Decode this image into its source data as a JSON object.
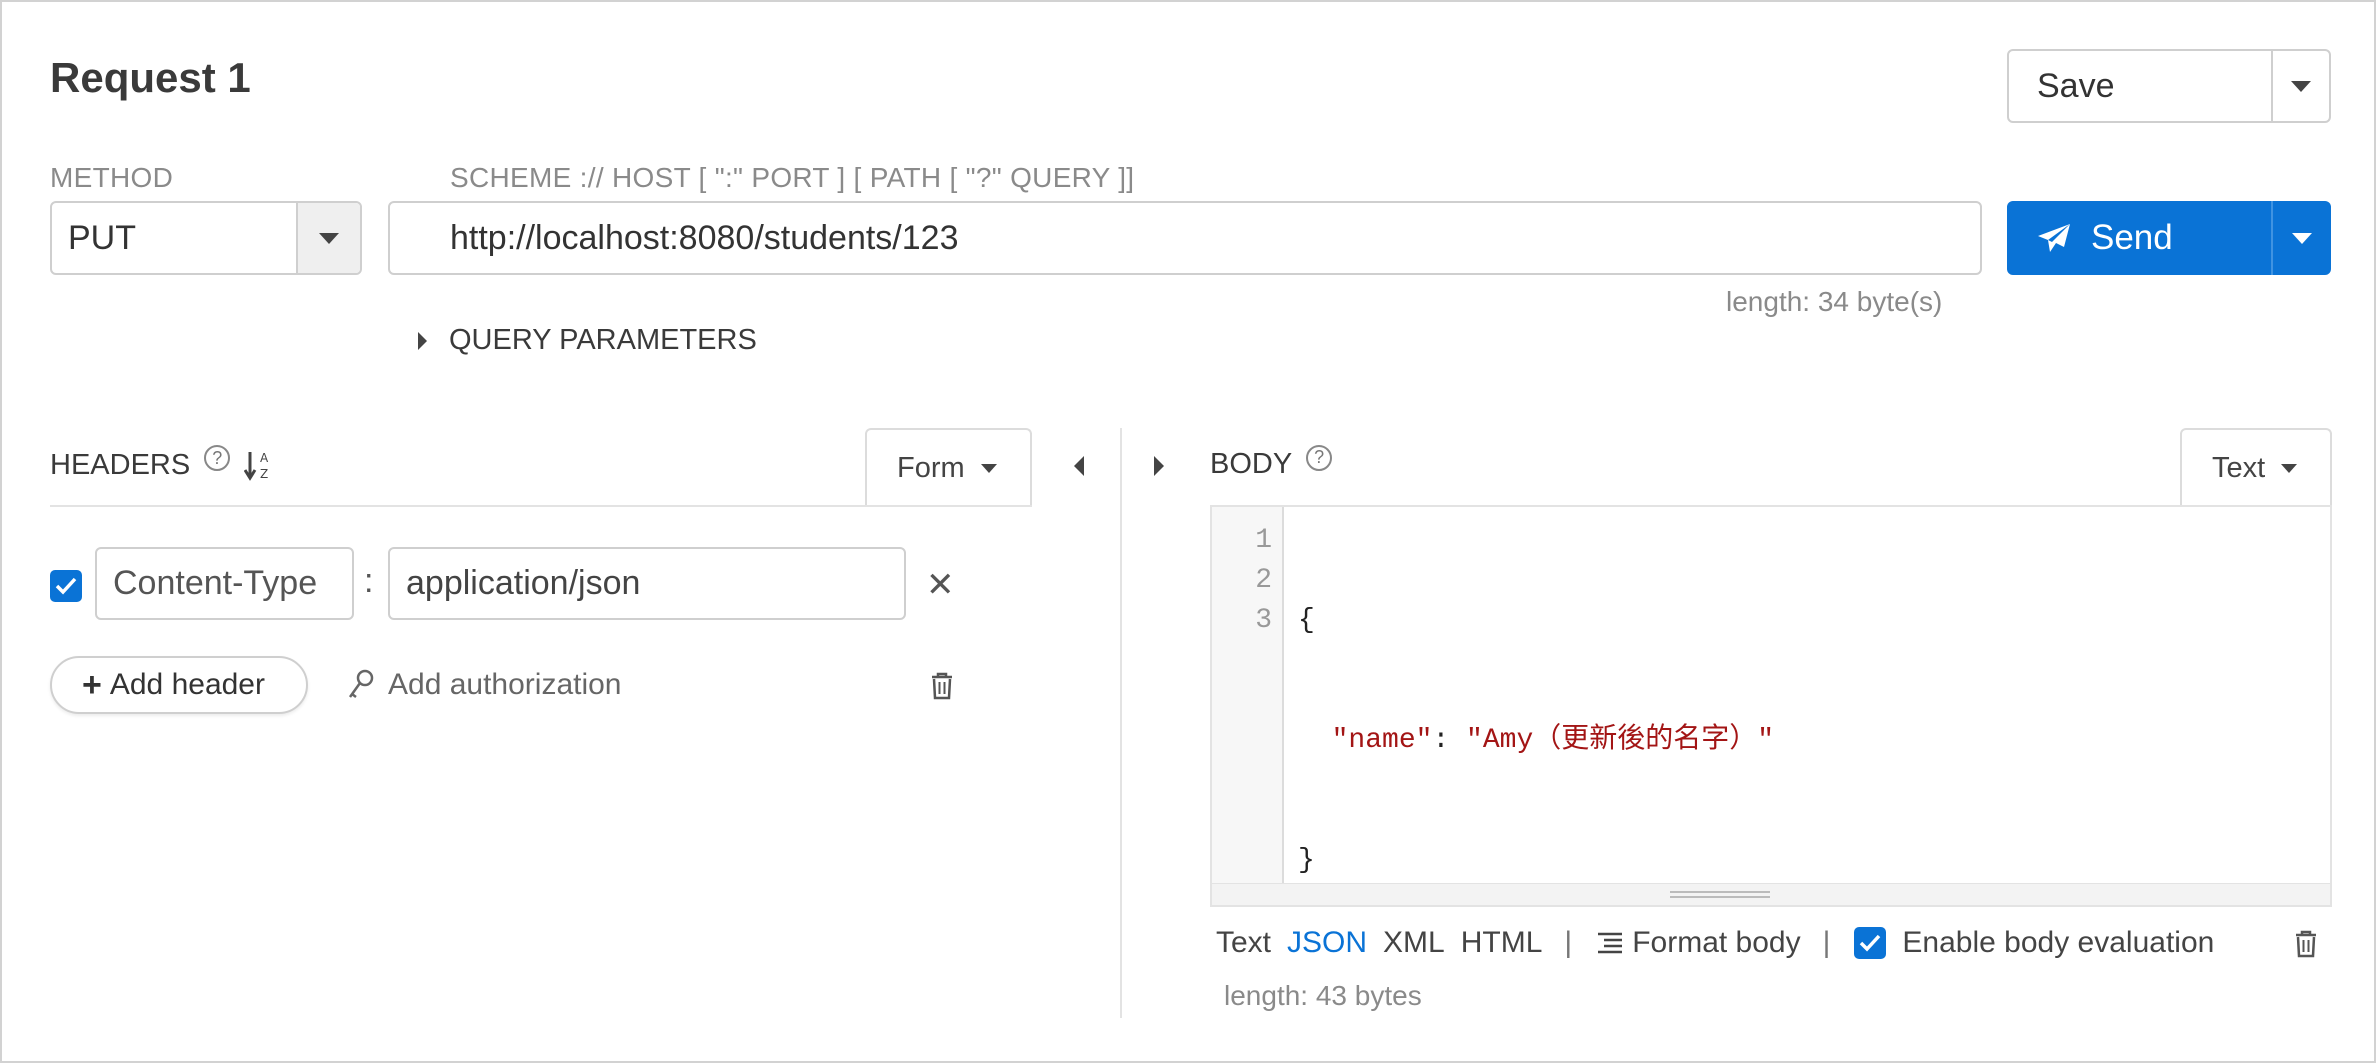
{
  "request": {
    "title": "Request 1"
  },
  "save": {
    "label": "Save"
  },
  "method": {
    "label": "METHOD",
    "value": "PUT"
  },
  "url": {
    "label": "SCHEME :// HOST [ \":\" PORT ] [ PATH [ \"?\" QUERY ]]",
    "value": "http://localhost:8080/students/123",
    "length": "length: 34 byte(s)"
  },
  "send": {
    "label": "Send",
    "accent": "#0a73d6"
  },
  "query": {
    "label": "QUERY PARAMETERS"
  },
  "headers": {
    "title": "HEADERS",
    "mode": "Form",
    "items": [
      {
        "enabled": true,
        "name": "Content-Type",
        "separator": ":",
        "value": "application/json"
      }
    ],
    "add_header_label": "Add header",
    "add_auth_label": "Add authorization"
  },
  "body": {
    "title": "BODY",
    "mode": "Text",
    "line_numbers": [
      "1",
      "2",
      "3"
    ],
    "code": {
      "line1": "{",
      "line2_key": "\"name\"",
      "line2_colon": ": ",
      "line2_value": "\"Amy（更新後的名字）\"",
      "line3": "}"
    },
    "formats": [
      "Text",
      "JSON",
      "XML",
      "HTML"
    ],
    "active_format": "JSON",
    "separator": "|",
    "format_label": "Format body",
    "eval_label": "Enable body evaluation",
    "eval_enabled": true,
    "length": "length: 43 bytes"
  },
  "icons": {
    "help": "help-circle-icon",
    "sort": "sort-alpha-icon",
    "send": "paper-plane-icon",
    "auth": "key-icon",
    "delete": "trash-icon",
    "remove": "close-icon",
    "format": "align-lines-icon"
  }
}
